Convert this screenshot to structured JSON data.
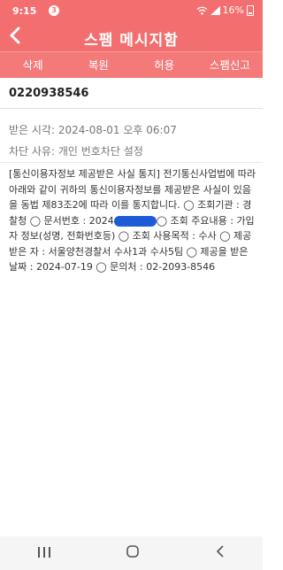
{
  "status_bar": {
    "time": "9:15",
    "notification_count": "3",
    "signal_text": "ᯤ",
    "battery_percent": "16%"
  },
  "header": {
    "back_icon": "chevron-left-icon",
    "title": "스팸 메시지함"
  },
  "toolbar": {
    "delete_label": "삭제",
    "restore_label": "복원",
    "allow_label": "허용",
    "report_label": "스팸신고"
  },
  "message": {
    "sender": "0220938546",
    "received_time": "받은 시각: 2024-08-01 오후 06:07",
    "block_reason": "차단 사유: 개인 번호차단 설정",
    "body_part1": "[통신이용자정보 제공받은 사실 통지] 전기통신사업법에 따라 아래와 같이 귀하의 통신이용자정보를 제공받은 사실이 있음을 동법 제83조2에 따라 이를 통지합니다. ◯ 조회기관 : 경찰청 ◯ 문서번호 : 2024",
    "body_part2": "◯ 조회 주요내용 : 가입자 정보(성명, 전화번호등) ◯ 조회 사용목적 : 수사 ◯ 제공받은 자 : 서울양천경찰서 수사1과 수사5팀 ◯ 제공을 받은 날짜 : 2024-07-19 ◯ 문의처 : 02-2093-8546"
  },
  "colors": {
    "accent": "#f36e6e",
    "toolbar": "#f47a7a",
    "redaction": "#1e5bd6"
  },
  "nav": {
    "recents_icon": "recents-icon",
    "home_icon": "home-icon",
    "back_icon": "back-icon"
  }
}
